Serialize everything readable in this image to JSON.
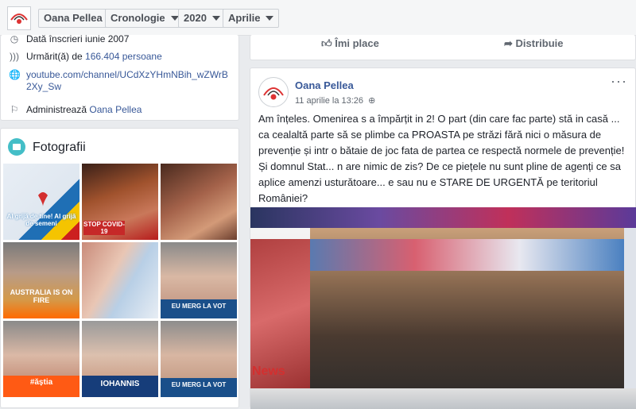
{
  "header": {
    "page_name": "Oana Pellea",
    "dropdowns": [
      "Cronologie",
      "2020",
      "Aprilie"
    ]
  },
  "about": {
    "creation": "Dată înscrieri iunie 2007",
    "followers_prefix": "Urmărit(ă) de ",
    "followers_count": "166.404 persoane",
    "url_line1": "youtube.com/channel/UCdXzYHmNBih_wZWrB",
    "url_line2": "2Xy_Sw",
    "admin_prefix": "Administrează ",
    "admin_name": "Oana Pellea"
  },
  "photos": {
    "title": "Fotografii",
    "items": [
      {
        "caption": "Al grijă de tine! Al grijă de semeni"
      },
      {
        "caption": "STOP COVID-19"
      },
      {
        "caption": ""
      },
      {
        "caption": "AUSTRALIA IS ON FIRE"
      },
      {
        "caption": ""
      },
      {
        "caption": "EU MERG LA VOT"
      },
      {
        "caption": "#ăștia"
      },
      {
        "caption": "IOHANNIS"
      },
      {
        "caption": "EU MERG LA VOT"
      }
    ]
  },
  "actions": {
    "like": "Îmi place",
    "share": "Distribuie"
  },
  "post": {
    "author": "Oana Pellea",
    "date": "11 aprilie la 13:26",
    "menu": "···",
    "text": "Am înțeles. Omenirea s a împărțit in 2! O part (din care fac parte) stă in casă ... ca cealaltă parte să se plimbe ca PROASTA pe străzi fără nici o măsura de prevenție și intr o bătaie de joc fata de partea ce respectă normele de prevenție! Și domnul Stat... n are nimic de zis? De ce piețele nu sunt pline de agenți ce sa aplice amenzi usturătoare... e sau nu e STARE DE URGENTĂ pe teritoriul României?",
    "image_badge": "News"
  },
  "colors": {
    "link": "#385898",
    "background": "#e9ebee"
  }
}
